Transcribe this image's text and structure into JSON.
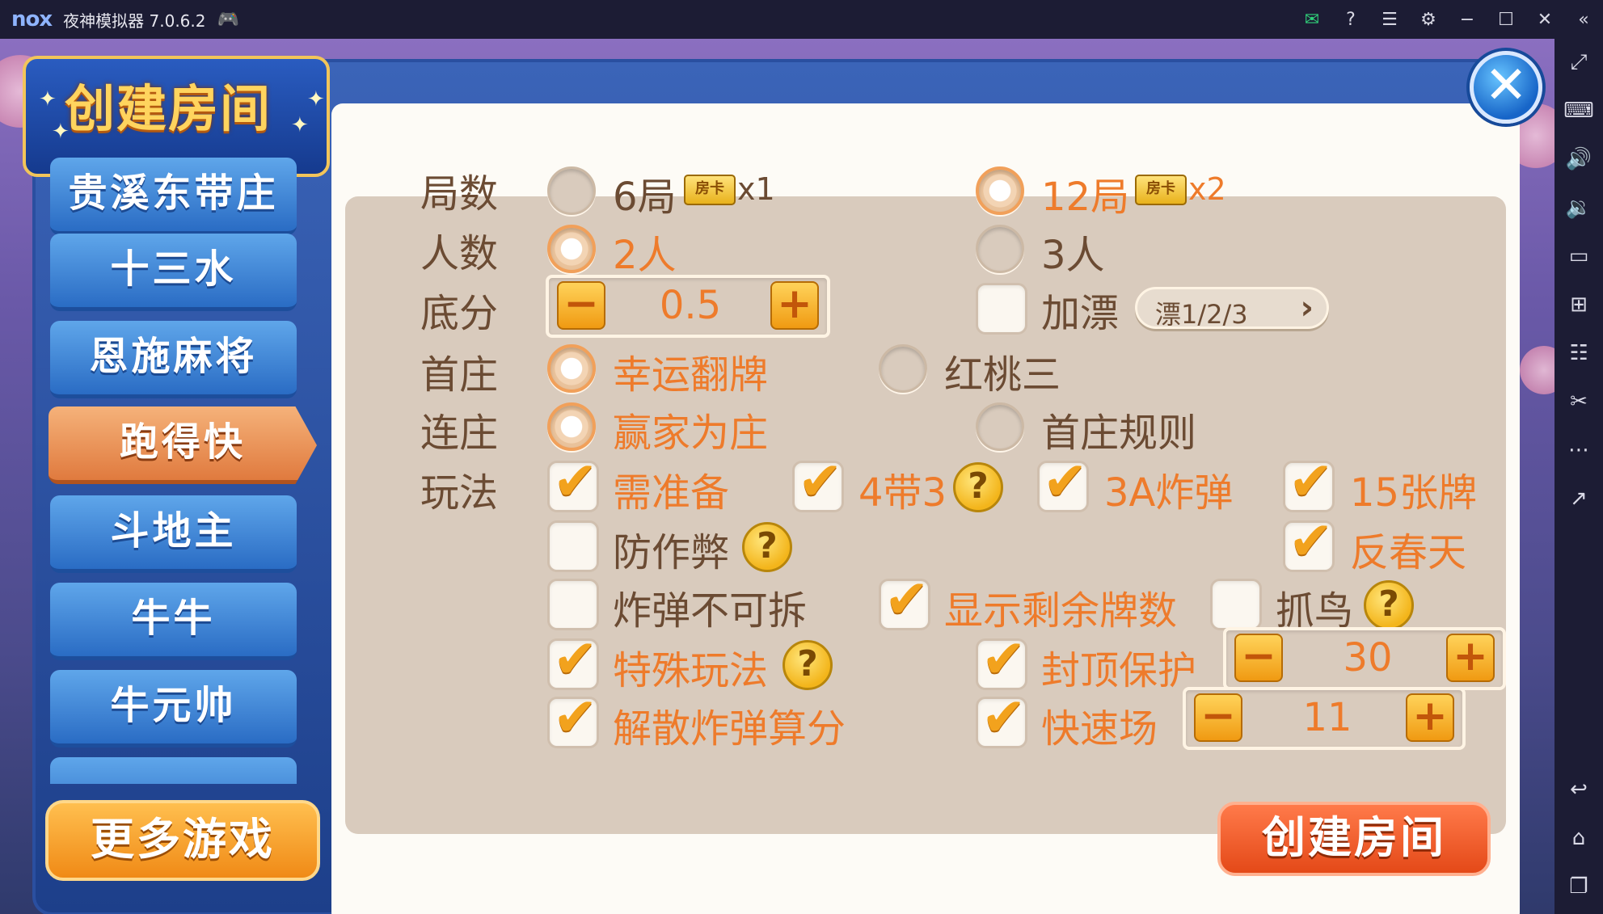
{
  "titlebar": {
    "logo": "nox",
    "title": "夜神模拟器 7.0.6.2",
    "icons": [
      "gamepad-icon",
      "mail-icon",
      "help-icon",
      "menu-icon",
      "settings-icon",
      "minimize-icon",
      "maximize-icon",
      "close-icon",
      "collapse-icon"
    ]
  },
  "sidebar_right": {
    "icons": [
      "fullscreen-icon",
      "keyboard-icon",
      "volume-up-icon",
      "volume-down-icon",
      "screen-icon",
      "apk-install-icon",
      "multi-open-icon",
      "scissors-icon",
      "more-icon",
      "share-icon",
      "back-icon",
      "home-icon",
      "recent-apps-icon"
    ]
  },
  "dialog": {
    "title": "创建房间",
    "close": "✕"
  },
  "games": [
    {
      "label": "贵溪东带庄",
      "active": false
    },
    {
      "label": "十三水",
      "active": false
    },
    {
      "label": "恩施麻将",
      "active": false
    },
    {
      "label": "跑得快",
      "active": true
    },
    {
      "label": "斗地主",
      "active": false
    },
    {
      "label": "牛牛",
      "active": false
    },
    {
      "label": "牛元帅",
      "active": false
    },
    {
      "label": "",
      "active": false
    }
  ],
  "more_games": "更多游戏",
  "create_room": "创建房间",
  "options": {
    "rounds": {
      "label": "局数",
      "choices": [
        {
          "text": "6局",
          "card": "房卡",
          "mult": "x1",
          "selected": false
        },
        {
          "text": "12局",
          "card": "房卡",
          "mult": "x2",
          "selected": true
        }
      ]
    },
    "players": {
      "label": "人数",
      "choices": [
        {
          "text": "2人",
          "selected": true
        },
        {
          "text": "3人",
          "selected": false
        }
      ]
    },
    "base_score": {
      "label": "底分",
      "minus": "−",
      "value": "0.5",
      "plus": "+",
      "piao_label": "加漂",
      "piao_checked": false,
      "piao_select": "漂1/2/3",
      "piao_chevron": "›"
    },
    "first_banker": {
      "label": "首庄",
      "choices": [
        {
          "text": "幸运翻牌",
          "selected": true
        },
        {
          "text": "红桃三",
          "selected": false
        }
      ]
    },
    "consecutive_banker": {
      "label": "连庄",
      "choices": [
        {
          "text": "赢家为庄",
          "selected": true
        },
        {
          "text": "首庄规则",
          "selected": false
        }
      ]
    },
    "play": {
      "label": "玩法",
      "check_mark": "✔",
      "help_mark": "?",
      "items": {
        "need_ready": {
          "text": "需准备",
          "checked": true
        },
        "four_with_three": {
          "text": "4带3",
          "checked": true
        },
        "three_a_bomb": {
          "text": "3A炸弹",
          "checked": true
        },
        "fifteen_cards": {
          "text": "15张牌",
          "checked": true
        },
        "anti_cheat": {
          "text": "防作弊",
          "checked": false
        },
        "reverse_spring": {
          "text": "反春天",
          "checked": true
        },
        "bomb_no_split": {
          "text": "炸弹不可拆",
          "checked": false
        },
        "show_remaining": {
          "text": "显示剩余牌数",
          "checked": true
        },
        "catch_bird": {
          "text": "抓鸟",
          "checked": false
        },
        "special_play": {
          "text": "特殊玩法",
          "checked": true
        },
        "cap_protect": {
          "text": "封顶保护",
          "checked": true,
          "value": "30"
        },
        "dissolve_bomb": {
          "text": "解散炸弹算分",
          "checked": true
        },
        "quick_game": {
          "text": "快速场",
          "checked": true,
          "value": "11"
        }
      }
    }
  },
  "colors": {
    "accent_orange": "#ee7b2b",
    "label_brown": "#6b4b33",
    "panel_blue": "#2a5cc0",
    "option_bg": "#d9cbbd"
  }
}
